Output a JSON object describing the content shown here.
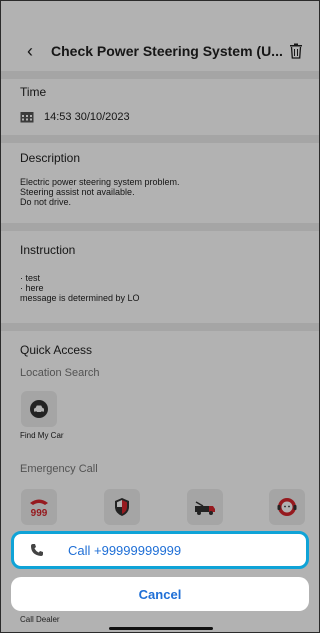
{
  "header": {
    "back_icon": "chevron-left-icon",
    "title": "Check Power Steering System (U...",
    "trash_icon": "trash-icon"
  },
  "time": {
    "label": "Time",
    "icon": "calendar-icon",
    "value": "14:53 30/10/2023"
  },
  "description": {
    "label": "Description",
    "lines": [
      "Electric power steering system problem.",
      "Steering assist not available.",
      "Do not drive."
    ]
  },
  "instruction": {
    "label": "Instruction",
    "lines": [
      "· test",
      "· here",
      "message is determined by LO"
    ]
  },
  "quick_access": {
    "label": "Quick Access",
    "location_search_label": "Location Search",
    "find_my_car_label": "Find My Car",
    "emergency_call_label": "Emergency Call",
    "emergency_icons": [
      "999-phone-icon",
      "shield-icon",
      "tow-truck-icon",
      "support-agent-icon"
    ]
  },
  "action_sheet": {
    "call_label": "Call +99999999999",
    "call_icon": "phone-icon",
    "cancel_label": "Cancel"
  },
  "footer": {
    "call_dealer_label": "Call Dealer"
  },
  "colors": {
    "accent": "#1f6fd6",
    "highlight_border": "#0fa3d7",
    "emergency_red": "#d7262d"
  }
}
